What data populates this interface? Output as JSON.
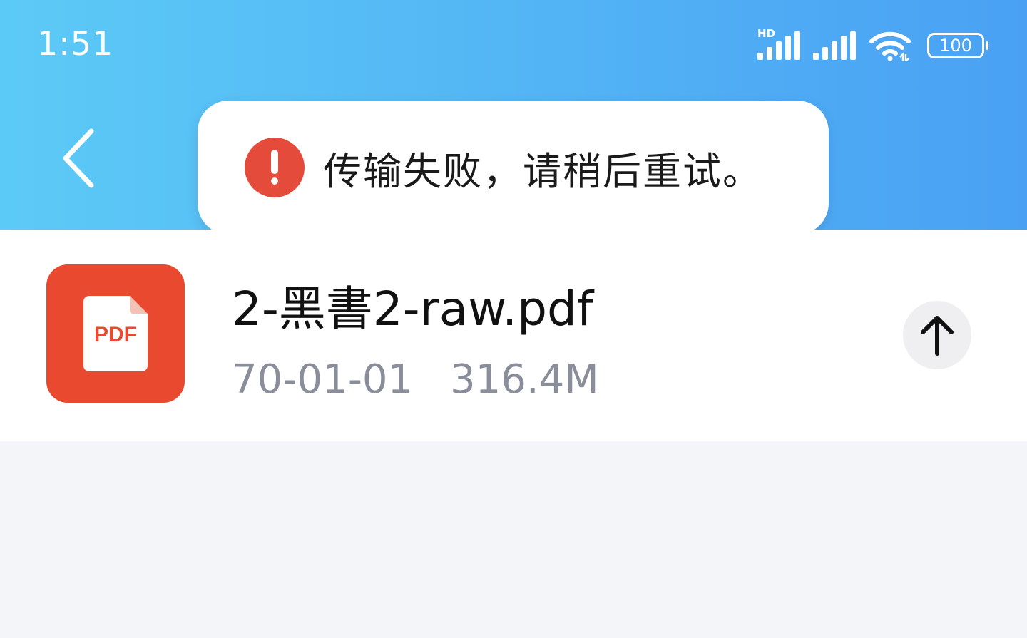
{
  "status_bar": {
    "time": "1:51",
    "network_label": "HD",
    "battery": "100",
    "icons": [
      "hd-signal-icon",
      "signal-icon",
      "wifi-icon",
      "battery-icon"
    ]
  },
  "header": {
    "back_icon": "chevron-left-icon"
  },
  "toast": {
    "icon": "error-icon",
    "message": "传输失败，请稍后重试。"
  },
  "file": {
    "type_label": "PDF",
    "name": "2-黑書2-raw.pdf",
    "date": "70-01-01",
    "size": "316.4M",
    "action_icon": "arrow-up-icon"
  },
  "colors": {
    "header_gradient_start": "#5ccaf6",
    "header_gradient_end": "#4aa1f4",
    "error": "#e54b3a",
    "pdf_red": "#e94a2f",
    "meta_gray": "#8a8d9a",
    "page_bg": "#f4f5f9"
  }
}
